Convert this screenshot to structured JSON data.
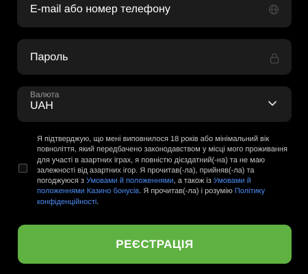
{
  "form": {
    "email_placeholder": "E-mail або номер телефону",
    "password_placeholder": "Пароль",
    "currency_label": "Валюта",
    "currency_value": "UAH",
    "icons": {
      "email": "globe-icon",
      "password": "lock-icon",
      "currency": "chevron-down-icon"
    }
  },
  "consent": {
    "text_1": "Я підтверджую, що мені виповнилося 18 років або мінімальний вік повноліття, який передбачено законодавством у місці мого проживання для участі в азартних іграх, я повністю дієздатний(-на) та не маю залежності від азартних ігор. Я прочитав(-ла), прийняв(-ла) та погоджуюся з ",
    "link_terms": "Умовами й положеннями",
    "text_2": ", а також із ",
    "link_bonus_terms": "Умовами й положеннями Казино бонусів",
    "text_3": ". Я прочитав(-ла) і розумію ",
    "link_privacy": "Політику конфіденційності",
    "text_4": "."
  },
  "register_label": "РЕЄСТРАЦІЯ",
  "colors": {
    "background": "#000000",
    "field_background": "#1c1c1c",
    "button": "#5fb142",
    "link": "#4d8df5"
  }
}
